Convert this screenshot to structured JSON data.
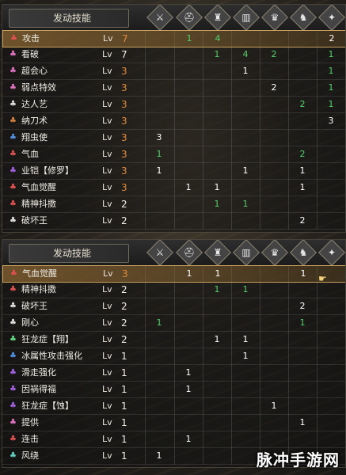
{
  "colors": {
    "accent_orange": "#e08a3c",
    "value_white": "#ffffff",
    "value_green": "#52d26a"
  },
  "header_icons": [
    "sword-icon",
    "armor-icon",
    "helmet-icon",
    "chest-icon",
    "gauntlet-icon",
    "boots-icon",
    "charm-icon"
  ],
  "panels": [
    {
      "title": "发动技能",
      "rows": [
        {
          "name": "攻击",
          "lv_label": "Lv",
          "lv": "7",
          "icon_color": "#e05050",
          "highlight": true,
          "cells": [
            "",
            "1",
            "4",
            "",
            "",
            "",
            "2"
          ],
          "cell_colors": [
            "",
            "g",
            "g",
            "",
            "",
            "",
            "w"
          ]
        },
        {
          "name": "看破",
          "lv_label": "Lv",
          "lv": "7",
          "icon_color": "#e070c0",
          "highlight": false,
          "cells": [
            "",
            "",
            "1",
            "4",
            "2",
            "",
            "1"
          ],
          "cell_colors": [
            "",
            "",
            "g",
            "g",
            "g",
            "",
            "g"
          ]
        },
        {
          "name": "超会心",
          "lv_label": "Lv",
          "lv": "3",
          "icon_color": "#e070c0",
          "highlight": false,
          "cells": [
            "",
            "",
            "",
            "1",
            "",
            "",
            "1"
          ],
          "cell_colors": [
            "",
            "",
            "",
            "w",
            "",
            "",
            "g"
          ]
        },
        {
          "name": "弱点特效",
          "lv_label": "Lv",
          "lv": "3",
          "icon_color": "#e070c0",
          "highlight": false,
          "cells": [
            "",
            "",
            "",
            "",
            "2",
            "",
            "1"
          ],
          "cell_colors": [
            "",
            "",
            "",
            "",
            "w",
            "",
            "g"
          ]
        },
        {
          "name": "达人艺",
          "lv_label": "Lv",
          "lv": "3",
          "icon_color": "#dddddd",
          "highlight": false,
          "cells": [
            "",
            "",
            "",
            "",
            "",
            "2",
            "1"
          ],
          "cell_colors": [
            "",
            "",
            "",
            "",
            "",
            "g",
            "g"
          ]
        },
        {
          "name": "纳刀术",
          "lv_label": "Lv",
          "lv": "3",
          "icon_color": "#d08040",
          "highlight": false,
          "cells": [
            "",
            "",
            "",
            "",
            "",
            "",
            "3"
          ],
          "cell_colors": [
            "",
            "",
            "",
            "",
            "",
            "",
            "w"
          ]
        },
        {
          "name": "翔虫使",
          "lv_label": "Lv",
          "lv": "3",
          "icon_color": "#5090e0",
          "highlight": false,
          "cells": [
            "3",
            "",
            "",
            "",
            "",
            "",
            ""
          ],
          "cell_colors": [
            "w",
            "",
            "",
            "",
            "",
            "",
            ""
          ]
        },
        {
          "name": "气血",
          "lv_label": "Lv",
          "lv": "3",
          "icon_color": "#e05050",
          "highlight": false,
          "cells": [
            "1",
            "",
            "",
            "",
            "",
            "2",
            ""
          ],
          "cell_colors": [
            "g",
            "",
            "",
            "",
            "",
            "g",
            ""
          ]
        },
        {
          "name": "业铠【修罗】",
          "lv_label": "Lv",
          "lv": "3",
          "icon_color": "#a060e0",
          "highlight": false,
          "cells": [
            "1",
            "",
            "",
            "1",
            "",
            "1",
            ""
          ],
          "cell_colors": [
            "w",
            "",
            "",
            "w",
            "",
            "w",
            ""
          ]
        },
        {
          "name": "气血觉醒",
          "lv_label": "Lv",
          "lv": "3",
          "icon_color": "#e05050",
          "highlight": false,
          "cells": [
            "",
            "1",
            "1",
            "",
            "",
            "1",
            ""
          ],
          "cell_colors": [
            "",
            "w",
            "w",
            "",
            "",
            "w",
            ""
          ]
        },
        {
          "name": "精神抖擞",
          "lv_label": "Lv",
          "lv": "2",
          "icon_color": "#e05050",
          "highlight": false,
          "cells": [
            "",
            "",
            "1",
            "1",
            "",
            "",
            ""
          ],
          "cell_colors": [
            "",
            "",
            "g",
            "g",
            "",
            "",
            ""
          ]
        },
        {
          "name": "破坏王",
          "lv_label": "Lv",
          "lv": "2",
          "icon_color": "#dddddd",
          "highlight": false,
          "cells": [
            "",
            "",
            "",
            "",
            "",
            "2",
            ""
          ],
          "cell_colors": [
            "",
            "",
            "",
            "",
            "",
            "w",
            ""
          ]
        }
      ]
    },
    {
      "title": "发动技能",
      "rows": [
        {
          "name": "气血觉醒",
          "lv_label": "Lv",
          "lv": "3",
          "icon_color": "#e05050",
          "highlight": true,
          "cells": [
            "",
            "1",
            "1",
            "",
            "",
            "1",
            ""
          ],
          "cell_colors": [
            "",
            "w",
            "w",
            "",
            "",
            "w",
            ""
          ]
        },
        {
          "name": "精神抖擞",
          "lv_label": "Lv",
          "lv": "2",
          "icon_color": "#e05050",
          "highlight": false,
          "cells": [
            "",
            "",
            "1",
            "1",
            "",
            "",
            ""
          ],
          "cell_colors": [
            "",
            "",
            "g",
            "g",
            "",
            "",
            ""
          ]
        },
        {
          "name": "破坏王",
          "lv_label": "Lv",
          "lv": "2",
          "icon_color": "#dddddd",
          "highlight": false,
          "cells": [
            "",
            "",
            "",
            "",
            "",
            "2",
            ""
          ],
          "cell_colors": [
            "",
            "",
            "",
            "",
            "",
            "w",
            ""
          ]
        },
        {
          "name": "刚心",
          "lv_label": "Lv",
          "lv": "2",
          "icon_color": "#dddddd",
          "highlight": false,
          "cells": [
            "1",
            "",
            "",
            "",
            "",
            "1",
            ""
          ],
          "cell_colors": [
            "g",
            "",
            "",
            "",
            "",
            "g",
            ""
          ]
        },
        {
          "name": "狂龙症【翔】",
          "lv_label": "Lv",
          "lv": "2",
          "icon_color": "#60d080",
          "highlight": false,
          "cells": [
            "",
            "",
            "1",
            "1",
            "",
            "",
            ""
          ],
          "cell_colors": [
            "",
            "",
            "w",
            "w",
            "",
            "",
            ""
          ]
        },
        {
          "name": "冰属性攻击强化",
          "lv_label": "Lv",
          "lv": "1",
          "icon_color": "#5090e0",
          "highlight": false,
          "cells": [
            "",
            "",
            "",
            "1",
            "",
            "",
            ""
          ],
          "cell_colors": [
            "",
            "",
            "",
            "w",
            "",
            "",
            ""
          ]
        },
        {
          "name": "滑走强化",
          "lv_label": "Lv",
          "lv": "1",
          "icon_color": "#a060e0",
          "highlight": false,
          "cells": [
            "",
            "1",
            "",
            "",
            "",
            "",
            ""
          ],
          "cell_colors": [
            "",
            "w",
            "",
            "",
            "",
            "",
            ""
          ]
        },
        {
          "name": "因祸得福",
          "lv_label": "Lv",
          "lv": "1",
          "icon_color": "#a060e0",
          "highlight": false,
          "cells": [
            "",
            "1",
            "",
            "",
            "",
            "",
            ""
          ],
          "cell_colors": [
            "",
            "w",
            "",
            "",
            "",
            "",
            ""
          ]
        },
        {
          "name": "狂龙症【蚀】",
          "lv_label": "Lv",
          "lv": "1",
          "icon_color": "#a060e0",
          "highlight": false,
          "cells": [
            "",
            "",
            "",
            "",
            "1",
            "",
            ""
          ],
          "cell_colors": [
            "",
            "",
            "",
            "",
            "w",
            "",
            ""
          ]
        },
        {
          "name": "提供",
          "lv_label": "Lv",
          "lv": "1",
          "icon_color": "#e070c0",
          "highlight": false,
          "cells": [
            "",
            "",
            "",
            "",
            "",
            "1",
            ""
          ],
          "cell_colors": [
            "",
            "",
            "",
            "",
            "",
            "w",
            ""
          ]
        },
        {
          "name": "连击",
          "lv_label": "Lv",
          "lv": "1",
          "icon_color": "#e05050",
          "highlight": false,
          "cells": [
            "",
            "1",
            "",
            "",
            "",
            "",
            ""
          ],
          "cell_colors": [
            "",
            "w",
            "",
            "",
            "",
            "",
            ""
          ]
        },
        {
          "name": "风绕",
          "lv_label": "Lv",
          "lv": "1",
          "icon_color": "#60d0c0",
          "highlight": false,
          "cells": [
            "1",
            "",
            "",
            "",
            "",
            "",
            ""
          ],
          "cell_colors": [
            "w",
            "",
            "",
            "",
            "",
            "",
            ""
          ]
        }
      ]
    }
  ],
  "watermark": "脉冲手游网"
}
